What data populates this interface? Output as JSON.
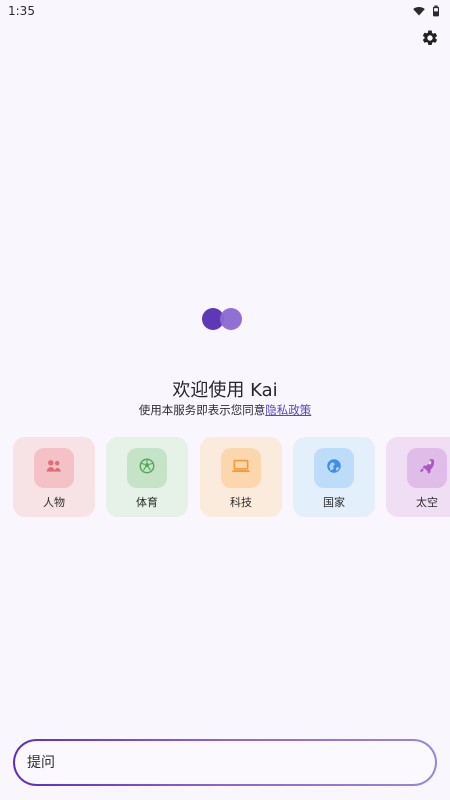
{
  "status_bar": {
    "time": "1:35",
    "icons": [
      "wifi-icon",
      "battery-icon"
    ]
  },
  "header": {
    "settings_icon": "gear-icon"
  },
  "logo": {
    "colors": {
      "left": "#5f38b8",
      "right": "#8b68d1"
    }
  },
  "welcome": {
    "title": "欢迎使用 Kai",
    "privacy_prefix": "使用本服务即表示您同意",
    "privacy_link": "隐私政策"
  },
  "categories": [
    {
      "label": "人物",
      "icon": "people-icon",
      "bg": "#f7e3e5",
      "icon_bg": "#f3c1c6",
      "icon_color": "#de6f78"
    },
    {
      "label": "体育",
      "icon": "soccer-ball-icon",
      "bg": "#e6f1e7",
      "icon_bg": "#c5e4c7",
      "icon_color": "#58a95d"
    },
    {
      "label": "科技",
      "icon": "laptop-icon",
      "bg": "#fbebdc",
      "icon_bg": "#fcd7ae",
      "icon_color": "#f29b39"
    },
    {
      "label": "国家",
      "icon": "globe-icon",
      "bg": "#e3effb",
      "icon_bg": "#bcdcfa",
      "icon_color": "#3e8fe5"
    },
    {
      "label": "太空",
      "icon": "rocket-icon",
      "bg": "#f0def4",
      "icon_bg": "#e0bde9",
      "icon_color": "#b055c4"
    }
  ],
  "ask": {
    "placeholder": "提问",
    "value": ""
  },
  "colors": {
    "background": "#f9f6fd",
    "accent": "#5d2ec1",
    "link": "#5b45c0"
  }
}
